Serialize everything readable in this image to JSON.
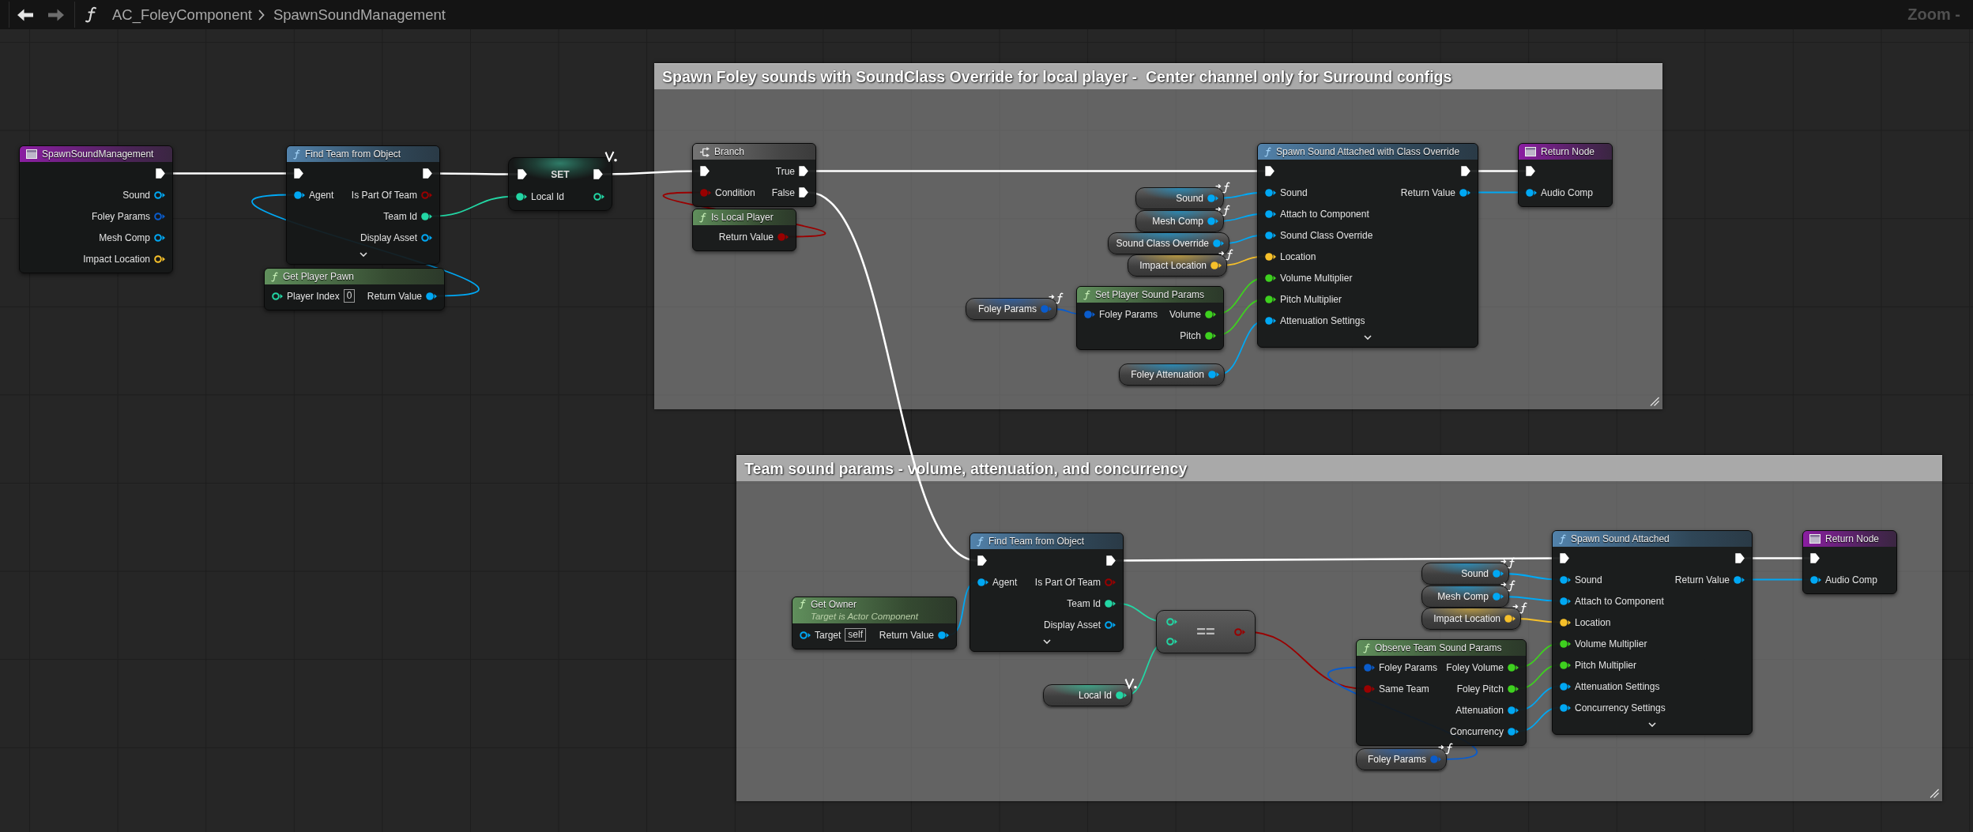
{
  "toolbar": {
    "nav": [
      {
        "kind": "back",
        "disabled": false
      },
      {
        "kind": "forward",
        "disabled": true
      }
    ],
    "breadcrumb": [
      "AC_FoleyComponent",
      "SpawnSoundManagement"
    ],
    "zoom": "Zoom -"
  },
  "graph": {
    "nodes": [
      {
        "kind": "entry",
        "title": "SpawnSoundManagement",
        "outputs": [
          {
            "kind": "exec",
            "filled": true
          },
          {
            "kind": "data",
            "label": "Sound",
            "color": "#00a8f4",
            "filled": false
          },
          {
            "kind": "data",
            "label": "Foley Params",
            "color": "#0a5ccc",
            "filled": false
          },
          {
            "kind": "data",
            "label": "Mesh Comp",
            "color": "#00a8f4",
            "filled": false
          },
          {
            "kind": "data",
            "label": "Impact Location",
            "color": "#f6c02a",
            "filled": false
          }
        ]
      },
      {
        "kind": "function",
        "title": "Find Team from Object",
        "advanced_collapsed": true,
        "inputs": [
          {
            "kind": "exec",
            "filled": true
          },
          {
            "kind": "data",
            "label": "Agent",
            "color": "#00a8f4",
            "filled": true
          }
        ],
        "outputs": [
          {
            "kind": "exec",
            "filled": true
          },
          {
            "kind": "data",
            "label": "Is Part Of Team",
            "color": "#9a0000",
            "filled": false
          },
          {
            "kind": "data",
            "label": "Team Id",
            "color": "#23d6a4",
            "filled": true
          },
          {
            "kind": "data",
            "label": "Display Asset",
            "color": "#00a8f4",
            "filled": false
          }
        ]
      },
      {
        "kind": "pure",
        "title": "Get Player Pawn",
        "inputs": [
          {
            "kind": "data",
            "label": "Player Index",
            "color": "#23d6a4",
            "filled": false,
            "default": "0"
          }
        ],
        "outputs": [
          {
            "kind": "data",
            "label": "Return Value",
            "color": "#00a8f4",
            "filled": true
          }
        ]
      },
      {
        "kind": "set",
        "title": "SET",
        "variable": {
          "kind": "local"
        },
        "inputs": [
          {
            "kind": "exec",
            "filled": true
          },
          {
            "kind": "data",
            "label": "Local Id",
            "color": "#23d6a4",
            "filled": true
          }
        ],
        "outputs": [
          {
            "kind": "exec",
            "filled": true
          },
          {
            "kind": "data",
            "color": "#23d6a4",
            "filled": false
          }
        ]
      }
    ],
    "comments": [
      {
        "title": "Spawn Foley sounds with SoundClass Override for local player -  Center channel only for Surround configs",
        "nodes": [
          {
            "kind": "branch",
            "title": "Branch",
            "inputs": [
              {
                "kind": "exec",
                "filled": true
              },
              {
                "kind": "data",
                "label": "Condition",
                "color": "#9a0000",
                "filled": true
              }
            ],
            "outputs": [
              {
                "kind": "exec",
                "label": "True",
                "filled": true
              },
              {
                "kind": "exec",
                "label": "False",
                "filled": true
              }
            ]
          },
          {
            "kind": "pure",
            "title": "Is Local Player",
            "outputs": [
              {
                "kind": "data",
                "label": "Return Value",
                "color": "#9a0000",
                "filled": true
              }
            ]
          },
          {
            "kind": "getter",
            "title": "Sound",
            "variable": {
              "kind": "parameter"
            },
            "outputs": [
              {
                "kind": "data",
                "color": "#00a8f4",
                "filled": true
              }
            ]
          },
          {
            "kind": "getter",
            "title": "Mesh Comp",
            "variable": {
              "kind": "parameter"
            },
            "outputs": [
              {
                "kind": "data",
                "color": "#00a8f4",
                "filled": true
              }
            ]
          },
          {
            "kind": "getter",
            "title": "Sound Class Override",
            "variable": {
              "kind": "member"
            },
            "outputs": [
              {
                "kind": "data",
                "color": "#00a8f4",
                "filled": true
              }
            ]
          },
          {
            "kind": "getter",
            "title": "Impact Location",
            "variable": {
              "kind": "parameter"
            },
            "outputs": [
              {
                "kind": "data",
                "color": "#f6c02a",
                "filled": true
              }
            ]
          },
          {
            "kind": "getter",
            "title": "Foley Params",
            "variable": {
              "kind": "parameter"
            },
            "outputs": [
              {
                "kind": "data",
                "color": "#0a5ccc",
                "filled": true
              }
            ]
          },
          {
            "kind": "pure",
            "title": "Set Player Sound Params",
            "inputs": [
              {
                "kind": "data",
                "label": "Foley Params",
                "color": "#0a5ccc",
                "filled": true
              }
            ],
            "outputs": [
              {
                "kind": "data",
                "label": "Volume",
                "color": "#3ed11f",
                "filled": true
              },
              {
                "kind": "data",
                "label": "Pitch",
                "color": "#3ed11f",
                "filled": true
              }
            ]
          },
          {
            "kind": "getter",
            "title": "Foley Attenuation",
            "variable": {
              "kind": "member"
            },
            "outputs": [
              {
                "kind": "data",
                "color": "#00a8f4",
                "filled": true
              }
            ]
          },
          {
            "kind": "function",
            "title": "Spawn Sound Attached with Class Override",
            "advanced_collapsed": true,
            "inputs": [
              {
                "kind": "exec",
                "filled": true
              },
              {
                "kind": "data",
                "label": "Sound",
                "color": "#00a8f4",
                "filled": true
              },
              {
                "kind": "data",
                "label": "Attach to Component",
                "color": "#00a8f4",
                "filled": true
              },
              {
                "kind": "data",
                "label": "Sound Class Override",
                "color": "#00a8f4",
                "filled": true
              },
              {
                "kind": "data",
                "label": "Location",
                "color": "#f6c02a",
                "filled": true
              },
              {
                "kind": "data",
                "label": "Volume Multiplier",
                "color": "#3ed11f",
                "filled": true
              },
              {
                "kind": "data",
                "label": "Pitch Multiplier",
                "color": "#3ed11f",
                "filled": true
              },
              {
                "kind": "data",
                "label": "Attenuation Settings",
                "color": "#00a8f4",
                "filled": true
              }
            ],
            "outputs": [
              {
                "kind": "exec",
                "filled": true
              },
              {
                "kind": "data",
                "label": "Return Value",
                "color": "#00a8f4",
                "filled": true
              }
            ]
          },
          {
            "kind": "return",
            "title": "Return Node",
            "inputs": [
              {
                "kind": "exec",
                "filled": true
              },
              {
                "kind": "data",
                "label": "Audio Comp",
                "color": "#00a8f4",
                "filled": true
              }
            ]
          }
        ]
      },
      {
        "title": "Team sound params - volume, attenuation, and concurrency",
        "nodes": [
          {
            "kind": "pure",
            "title": "Get Owner",
            "subtitle": "Target is Actor Component",
            "inputs": [
              {
                "kind": "data",
                "label": "Target",
                "color": "#00a8f4",
                "filled": false,
                "default": "self"
              }
            ],
            "outputs": [
              {
                "kind": "data",
                "label": "Return Value",
                "color": "#00a8f4",
                "filled": true
              }
            ]
          },
          {
            "kind": "function",
            "title": "Find Team from Object",
            "advanced_collapsed": true,
            "inputs": [
              {
                "kind": "exec",
                "filled": true
              },
              {
                "kind": "data",
                "label": "Agent",
                "color": "#00a8f4",
                "filled": true
              }
            ],
            "outputs": [
              {
                "kind": "exec",
                "filled": true
              },
              {
                "kind": "data",
                "label": "Is Part Of Team",
                "color": "#9a0000",
                "filled": false
              },
              {
                "kind": "data",
                "label": "Team Id",
                "color": "#23d6a4",
                "filled": true
              },
              {
                "kind": "data",
                "label": "Display Asset",
                "color": "#00a8f4",
                "filled": false
              }
            ]
          },
          {
            "kind": "getter",
            "title": "Local Id",
            "variable": {
              "kind": "local"
            },
            "outputs": [
              {
                "kind": "data",
                "color": "#23d6a4",
                "filled": true
              }
            ]
          },
          {
            "kind": "compare",
            "title": "==",
            "inputs": [
              {
                "kind": "data",
                "color": "#23d6a4",
                "filled": false
              },
              {
                "kind": "data",
                "color": "#23d6a4",
                "filled": false
              }
            ],
            "outputs": [
              {
                "kind": "data",
                "color": "#9a0000",
                "filled": false
              }
            ]
          },
          {
            "kind": "getter",
            "title": "Sound",
            "variable": {
              "kind": "parameter"
            },
            "outputs": [
              {
                "kind": "data",
                "color": "#00a8f4",
                "filled": true
              }
            ]
          },
          {
            "kind": "getter",
            "title": "Mesh Comp",
            "variable": {
              "kind": "parameter"
            },
            "outputs": [
              {
                "kind": "data",
                "color": "#00a8f4",
                "filled": true
              }
            ]
          },
          {
            "kind": "getter",
            "title": "Impact Location",
            "variable": {
              "kind": "parameter"
            },
            "outputs": [
              {
                "kind": "data",
                "color": "#f6c02a",
                "filled": true
              }
            ]
          },
          {
            "kind": "pure",
            "title": "Observe Team Sound Params",
            "inputs": [
              {
                "kind": "data",
                "label": "Foley Params",
                "color": "#0a5ccc",
                "filled": true
              },
              {
                "kind": "data",
                "label": "Same Team",
                "color": "#9a0000",
                "filled": true
              }
            ],
            "outputs": [
              {
                "kind": "data",
                "label": "Foley Volume",
                "color": "#3ed11f",
                "filled": true
              },
              {
                "kind": "data",
                "label": "Foley Pitch",
                "color": "#3ed11f",
                "filled": true
              },
              {
                "kind": "data",
                "label": "Attenuation",
                "color": "#00a8f4",
                "filled": true
              },
              {
                "kind": "data",
                "label": "Concurrency",
                "color": "#00a8f4",
                "filled": true
              }
            ]
          },
          {
            "kind": "getter",
            "title": "Foley Params",
            "variable": {
              "kind": "parameter"
            },
            "outputs": [
              {
                "kind": "data",
                "color": "#0a5ccc",
                "filled": true
              }
            ]
          },
          {
            "kind": "function",
            "title": "Spawn Sound Attached",
            "advanced_collapsed": true,
            "inputs": [
              {
                "kind": "exec",
                "filled": true
              },
              {
                "kind": "data",
                "label": "Sound",
                "color": "#00a8f4",
                "filled": true
              },
              {
                "kind": "data",
                "label": "Attach to Component",
                "color": "#00a8f4",
                "filled": true
              },
              {
                "kind": "data",
                "label": "Location",
                "color": "#f6c02a",
                "filled": true
              },
              {
                "kind": "data",
                "label": "Volume Multiplier",
                "color": "#3ed11f",
                "filled": true
              },
              {
                "kind": "data",
                "label": "Pitch Multiplier",
                "color": "#3ed11f",
                "filled": true
              },
              {
                "kind": "data",
                "label": "Attenuation Settings",
                "color": "#00a8f4",
                "filled": true
              },
              {
                "kind": "data",
                "label": "Concurrency Settings",
                "color": "#00a8f4",
                "filled": true
              }
            ],
            "outputs": [
              {
                "kind": "exec",
                "filled": true
              },
              {
                "kind": "data",
                "label": "Return Value",
                "color": "#00a8f4",
                "filled": true
              }
            ]
          },
          {
            "kind": "return",
            "title": "Return Node",
            "inputs": [
              {
                "kind": "exec",
                "filled": true
              },
              {
                "kind": "data",
                "label": "Audio Comp",
                "color": "#00a8f4",
                "filled": true
              }
            ]
          }
        ]
      }
    ]
  }
}
